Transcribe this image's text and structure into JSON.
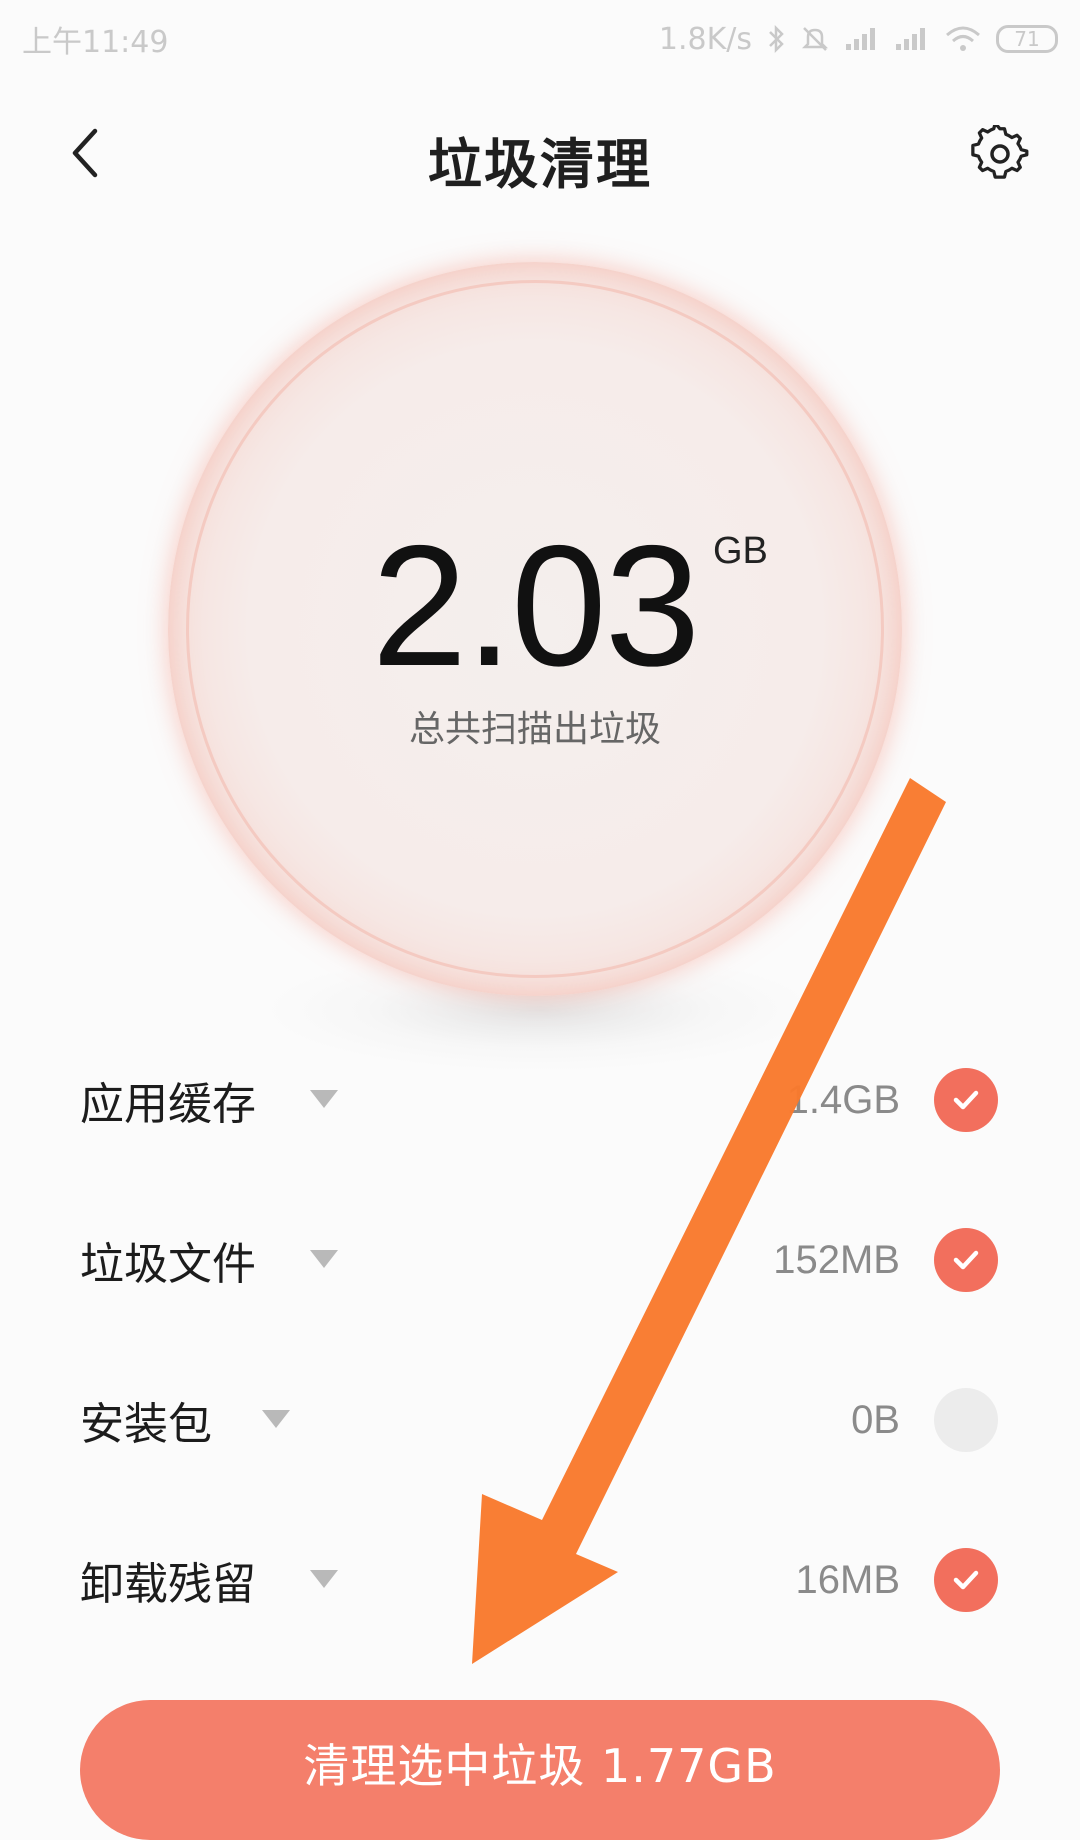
{
  "status_bar": {
    "time": "上午11:49",
    "network_speed": "1.8K/s",
    "battery_level": "71",
    "icons": [
      "bluetooth-icon",
      "mute-icon",
      "signal-icon",
      "signal-icon",
      "wifi-icon",
      "battery-icon"
    ]
  },
  "header": {
    "title": "垃圾清理",
    "back_icon": "chevron-left-icon",
    "settings_icon": "gear-icon"
  },
  "summary": {
    "value": "2.03",
    "unit": "GB",
    "caption": "总共扫描出垃圾"
  },
  "items": [
    {
      "label": "应用缓存",
      "size": "1.4GB",
      "checked": true
    },
    {
      "label": "垃圾文件",
      "size": "152MB",
      "checked": true
    },
    {
      "label": "安装包",
      "size": "0B",
      "checked": false
    },
    {
      "label": "卸载残留",
      "size": "16MB",
      "checked": true
    }
  ],
  "clean_button": {
    "label": "清理选中垃圾 1.77GB"
  },
  "colors": {
    "accent": "#f26f5d",
    "button": "#f47f6b",
    "annotation_arrow": "#f97a2d"
  }
}
